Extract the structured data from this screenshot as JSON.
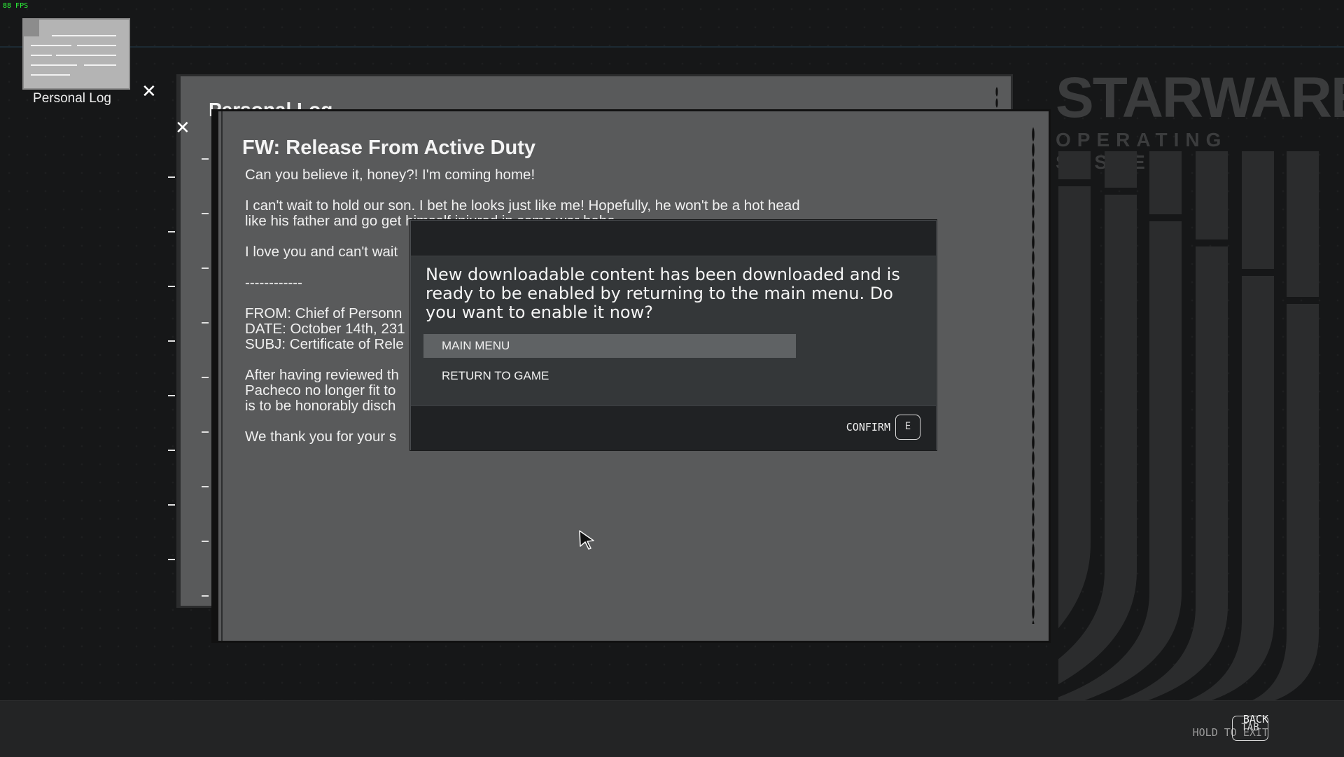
{
  "hud": {
    "fps": "88 FPS"
  },
  "brand": {
    "title": "STARWARE",
    "subtitle": "OPERATING SYSTEM"
  },
  "desktop": {
    "icon_label": "Personal Log",
    "icon_name": "document-icon"
  },
  "windows": {
    "back_title": "Personal Log",
    "front": {
      "title": "FW: Release From Active Duty",
      "lines": [
        "Can you believe it, honey?! I'm coming home!",
        "I can't wait to hold our son. I bet he looks just like me! Hopefully, he won't be a hot head",
        "like his father and go get himself injured in some war haha.",
        "I love you and can't wait",
        "------------",
        "FROM: Chief of Personn",
        "DATE: October 14th, 231",
        "SUBJ: Certificate of Rele",
        "After having reviewed th",
        "Pacheco no longer fit to",
        "is to be honorably disch",
        "We thank you for your s"
      ]
    }
  },
  "dialog": {
    "message": "New downloadable content has been downloaded and is ready to be enabled by returning to the main menu. Do you want to enable it now?",
    "options": [
      "MAIN MENU",
      "RETURN TO GAME"
    ],
    "selected_index": 0,
    "confirm_label": "CONFIRM",
    "confirm_key": "E"
  },
  "footer": {
    "back_label": "BACK",
    "hold_label": "HOLD TO EXIT",
    "key": "TAB"
  },
  "colors": {
    "background": "#161718",
    "window": "#595a5b",
    "dialog": "#343739",
    "dialog_header": "#202224",
    "selection": "#5f6264",
    "fps": "#2dff3a"
  }
}
